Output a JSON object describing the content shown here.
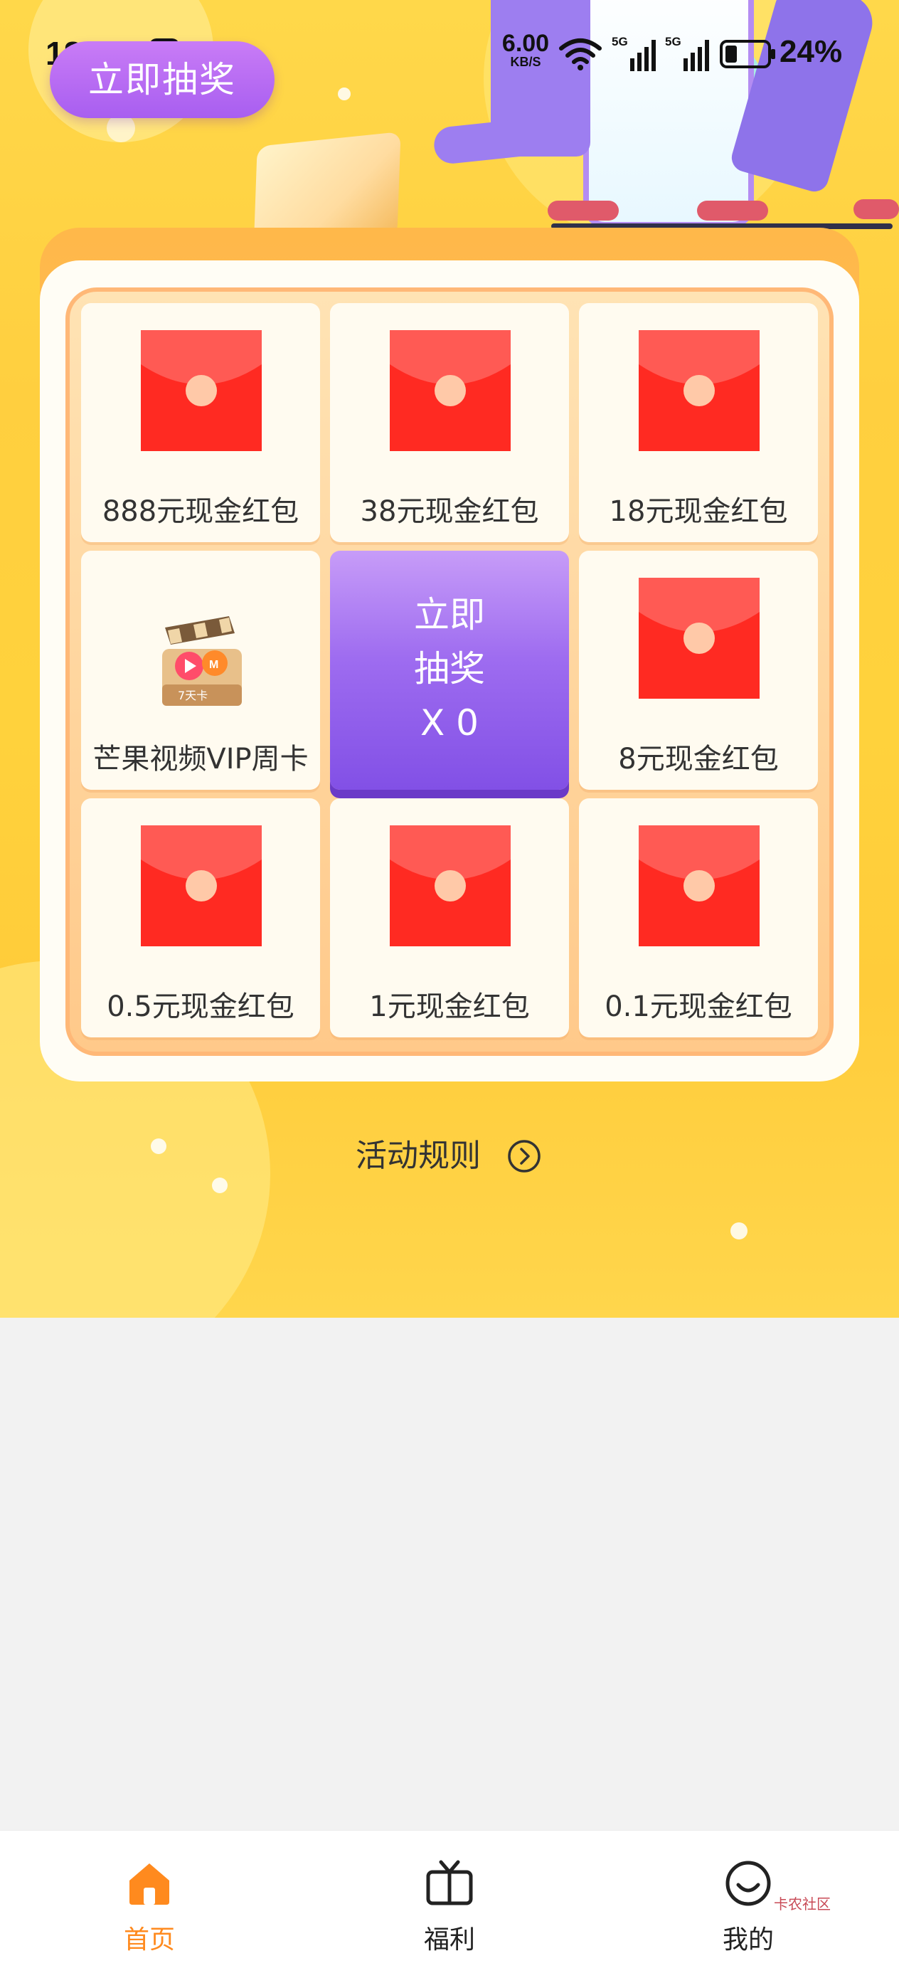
{
  "status_bar": {
    "time": "18:57",
    "net_speed_value": "6.00",
    "net_speed_unit": "KB/S",
    "signal_a": "5G",
    "signal_b": "5G",
    "battery": "24%"
  },
  "header": {
    "draw_button_label": "立即抽奖"
  },
  "board": {
    "cells": [
      {
        "label": "888元现金红包",
        "icon": "red-envelope-icon"
      },
      {
        "label": "38元现金红包",
        "icon": "red-envelope-icon"
      },
      {
        "label": "18元现金红包",
        "icon": "red-envelope-icon"
      },
      {
        "label": "芒果视频VIP周卡",
        "icon": "vip-card-icon"
      },
      {
        "label": "8元现金红包",
        "icon": "red-envelope-icon"
      },
      {
        "label": "0.5元现金红包",
        "icon": "red-envelope-icon"
      },
      {
        "label": "1元现金红包",
        "icon": "red-envelope-icon"
      },
      {
        "label": "0.1元现金红包",
        "icon": "red-envelope-icon"
      }
    ],
    "center": {
      "line1": "立即",
      "line2": "抽奖",
      "line3": "X 0"
    },
    "vip_card_badge": "7天卡"
  },
  "rules": {
    "label": "活动规则"
  },
  "tab_bar": {
    "tabs": [
      {
        "label": "首页",
        "icon": "home-icon",
        "active": true
      },
      {
        "label": "福利",
        "icon": "tv-icon",
        "active": false
      },
      {
        "label": "我的",
        "icon": "smile-icon",
        "active": false
      }
    ]
  },
  "watermark": "卡农社区",
  "colors": {
    "accent_orange": "#ff8a1e",
    "brand_purple": "#a85ef0",
    "envelope_red": "#ff2a22"
  }
}
